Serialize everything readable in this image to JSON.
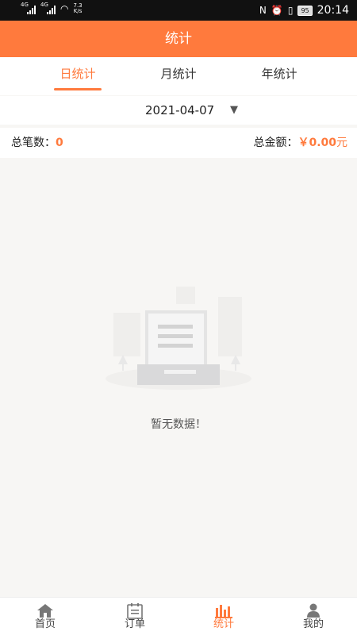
{
  "status_bar": {
    "sim1": "4G",
    "sim2": "4G",
    "speed_value": "7.3",
    "speed_unit": "K/s",
    "nfc": "N",
    "battery": "95",
    "time": "20:14"
  },
  "header": {
    "title": "统计"
  },
  "tabs": [
    {
      "label": "日统计",
      "active": true
    },
    {
      "label": "月统计",
      "active": false
    },
    {
      "label": "年统计",
      "active": false
    }
  ],
  "date_picker": {
    "value": "2021-04-07"
  },
  "summary": {
    "count_label": "总笔数：",
    "count_value": "0",
    "amount_label": "总金额：",
    "amount_value": "￥0.00",
    "amount_unit": "元"
  },
  "empty_state": {
    "text": "暂无数据！"
  },
  "bottom_nav": [
    {
      "label": "首页",
      "icon": "home-icon",
      "active": false
    },
    {
      "label": "订单",
      "icon": "order-list-icon",
      "active": false
    },
    {
      "label": "统计",
      "icon": "bar-chart-icon",
      "active": true
    },
    {
      "label": "我的",
      "icon": "user-icon",
      "active": false
    }
  ],
  "colors": {
    "accent": "#ff7a3d",
    "background": "#f7f6f4",
    "status_bar": "#111111"
  }
}
